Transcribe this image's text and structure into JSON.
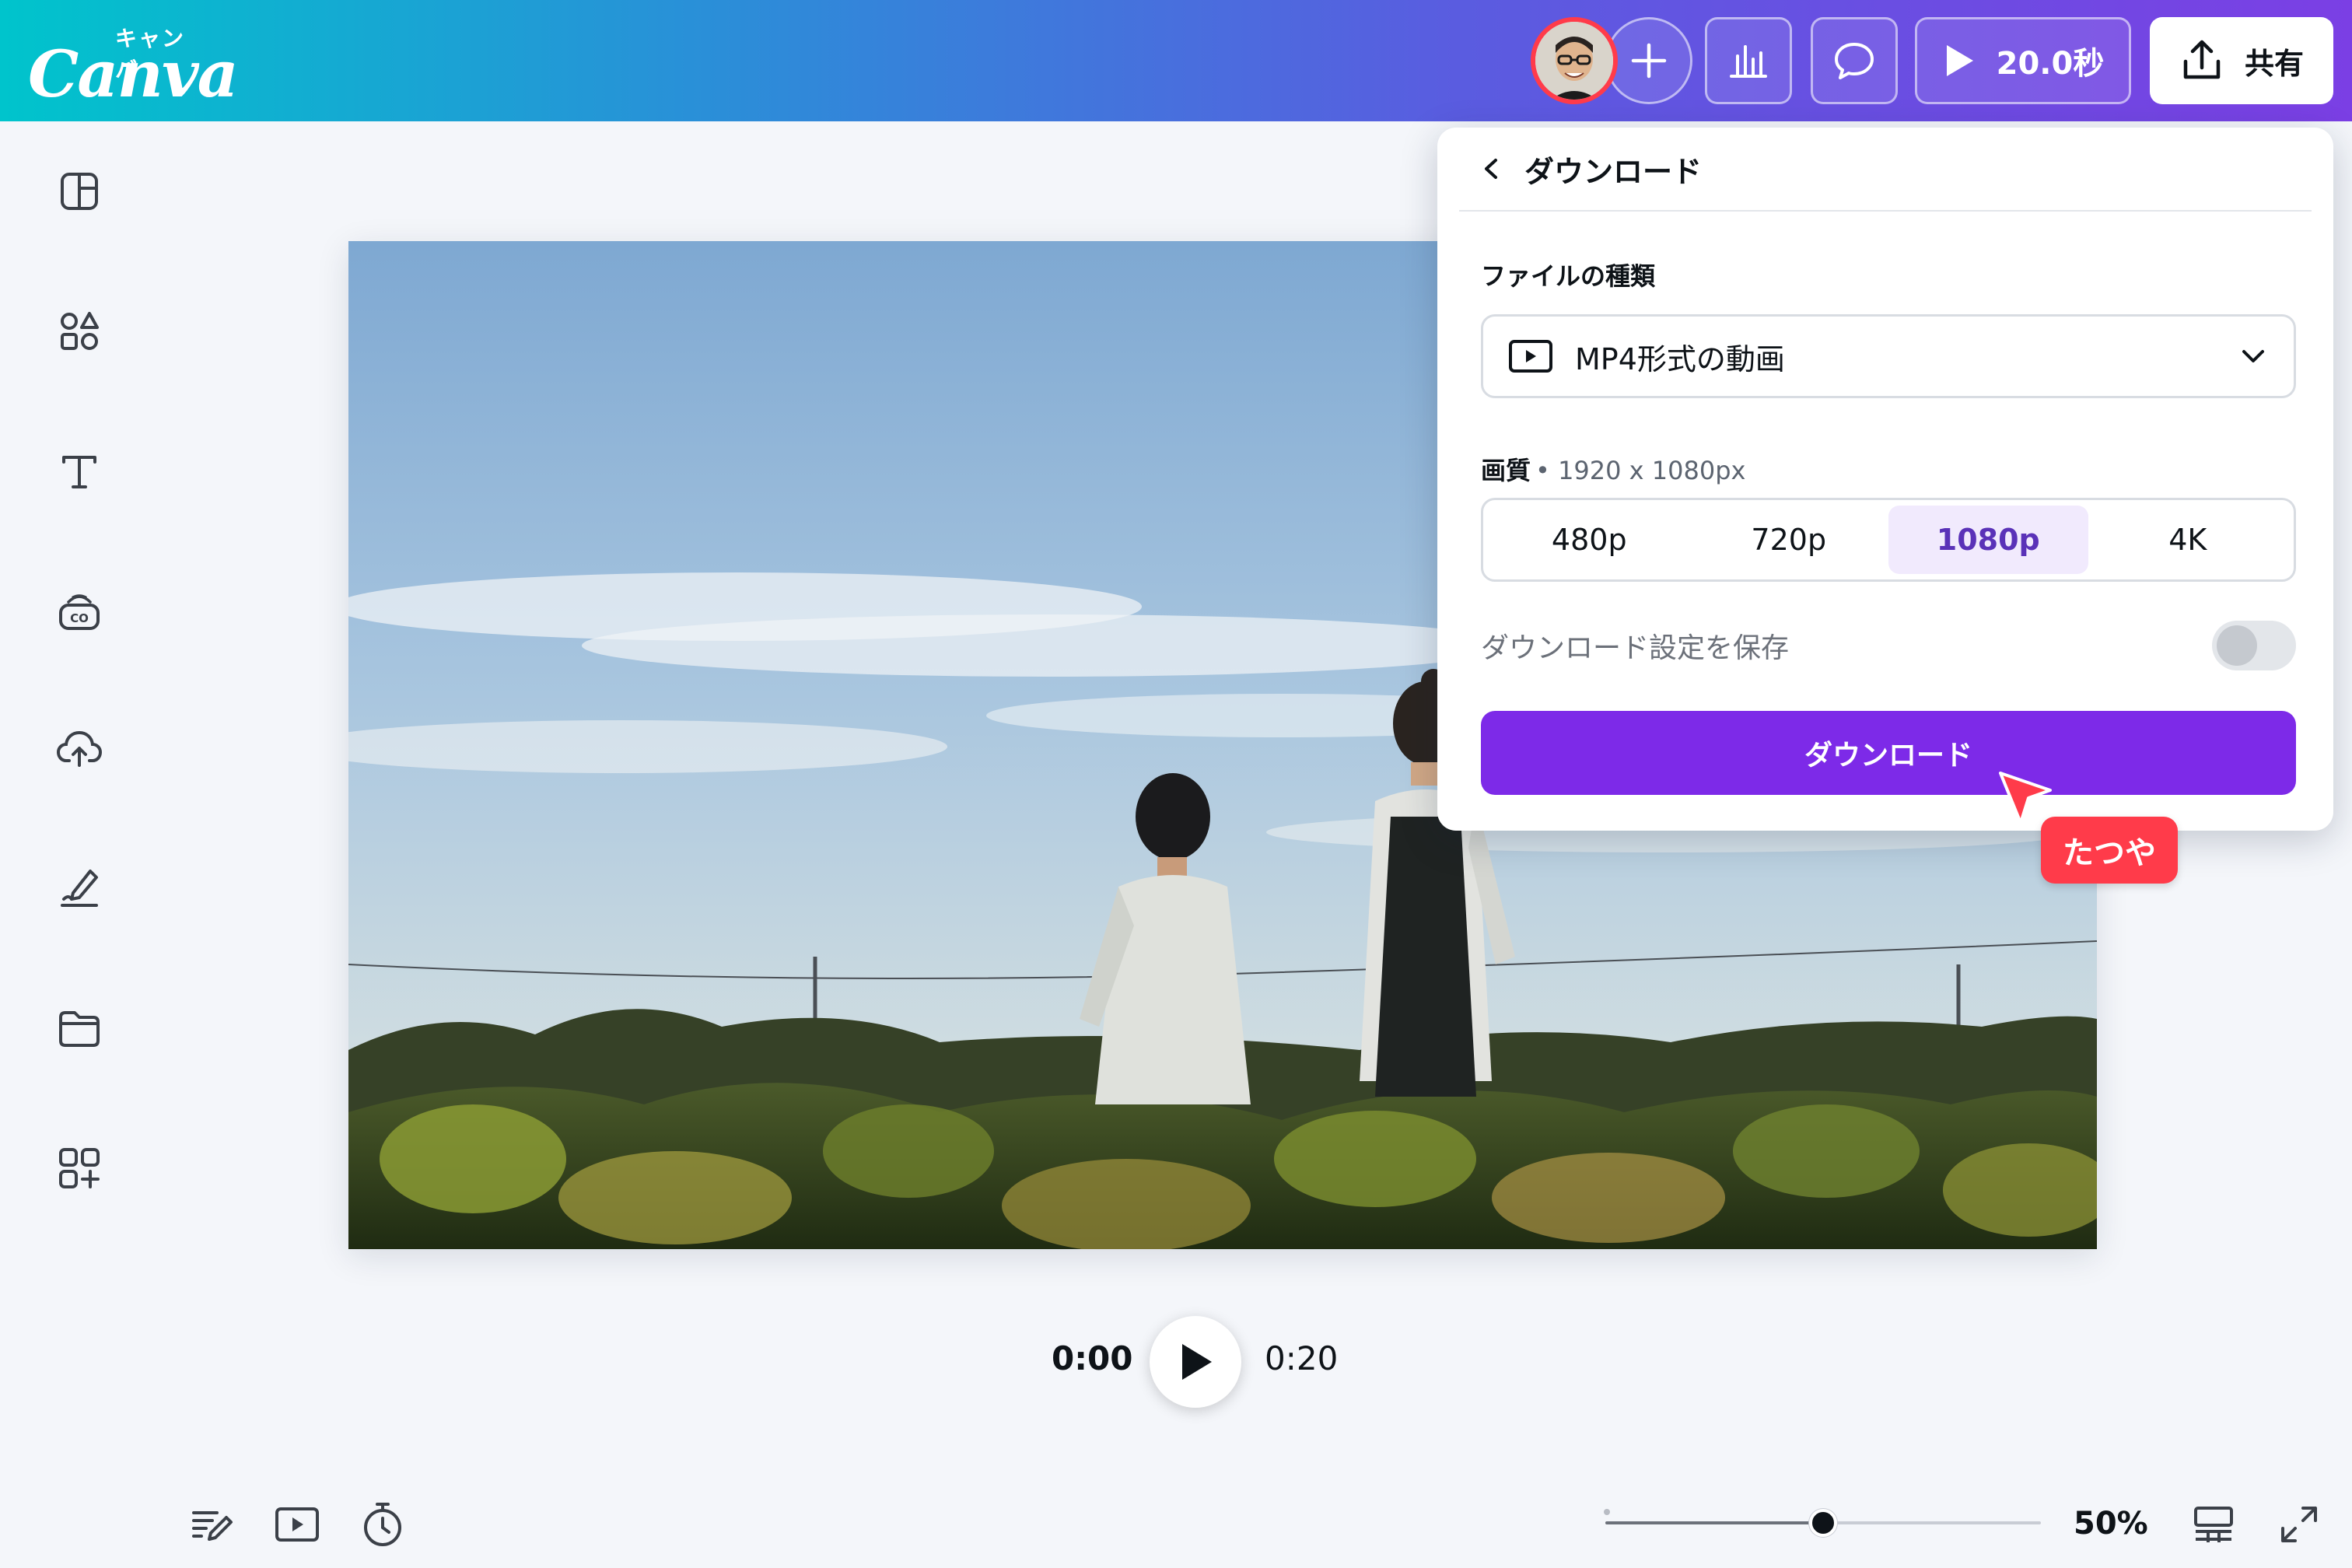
{
  "app": {
    "logo_sub": "キャンバ",
    "logo_main": "Canva"
  },
  "topbar": {
    "add_icon": "plus-icon",
    "stats_icon": "bar-chart-icon",
    "comment_icon": "comment-icon",
    "play_label": "20.0秒",
    "share_label": "共有"
  },
  "sidebar": {
    "items": [
      {
        "icon": "layout-icon"
      },
      {
        "icon": "elements-icon"
      },
      {
        "icon": "text-icon"
      },
      {
        "icon": "brand-icon"
      },
      {
        "icon": "upload-icon"
      },
      {
        "icon": "draw-icon"
      },
      {
        "icon": "folder-icon"
      },
      {
        "icon": "apps-icon"
      }
    ]
  },
  "playback": {
    "current": "0:00",
    "duration": "0:20"
  },
  "bottombar": {
    "zoom_label": "50%",
    "zoom_level": 0.5
  },
  "download_panel": {
    "title": "ダウンロード",
    "file_type_label": "ファイルの種類",
    "file_type_value": "MP4形式の動画",
    "quality_label": "画質",
    "quality_sub": "• 1920 x 1080px",
    "quality_options": [
      "480p",
      "720p",
      "1080p",
      "4K"
    ],
    "quality_selected": "1080p",
    "save_settings_label": "ダウンロード設定を保存",
    "save_settings_on": false,
    "download_button": "ダウンロード"
  },
  "collaborator": {
    "name": "たつや",
    "color": "#ff3b4a"
  },
  "colors": {
    "accent": "#7d2ae8",
    "topbar_start": "#00c4cc",
    "topbar_end": "#7b3fe4"
  }
}
